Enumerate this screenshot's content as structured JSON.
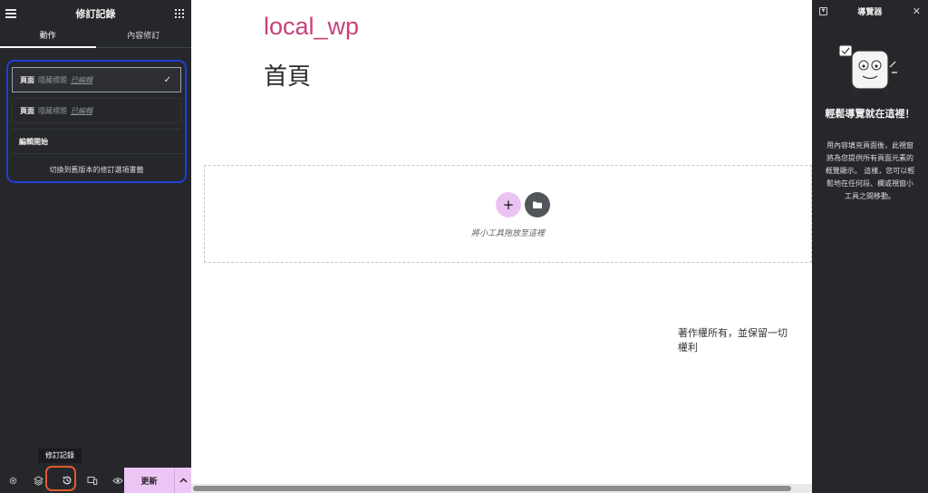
{
  "left_panel": {
    "title": "修訂記錄",
    "tabs": [
      {
        "label": "動作",
        "active": true
      },
      {
        "label": "內容修訂",
        "active": false
      }
    ],
    "history_items": [
      {
        "title": "頁面",
        "action": "隱藏標題",
        "status": "已編輯",
        "active": true
      },
      {
        "title": "頁面",
        "action": "隱藏標題",
        "status": "已編輯",
        "active": false
      }
    ],
    "editing_started": "編輯開始",
    "revert_link": "切換到舊版本的修訂選項書籤",
    "tooltip": "修訂記錄",
    "update_label": "更新",
    "footer_icons": [
      "gear-icon",
      "layers-icon",
      "history-icon",
      "responsive-icon",
      "eye-icon"
    ]
  },
  "canvas": {
    "site_title": "local_wp",
    "page_heading": "首頁",
    "drop_text": "將小工具拖放至這裡",
    "copyright": "著作權所有，並保留一切權利"
  },
  "navigator": {
    "title": "導覽器",
    "heading": "輕鬆導覽就在這裡！",
    "description": "用內容填充頁面後，此視窗將為您提供所有頁面元素的概覽顯示。 這樣，您可以輕鬆地在任何段、欄或視窗小工具之間移動。"
  },
  "colors": {
    "panel_bg": "#26272b",
    "accent_pink": "#eec6f6",
    "site_title": "#c7427a",
    "highlight_blue": "#1f3fd6",
    "highlight_orange": "#e05a2e"
  }
}
